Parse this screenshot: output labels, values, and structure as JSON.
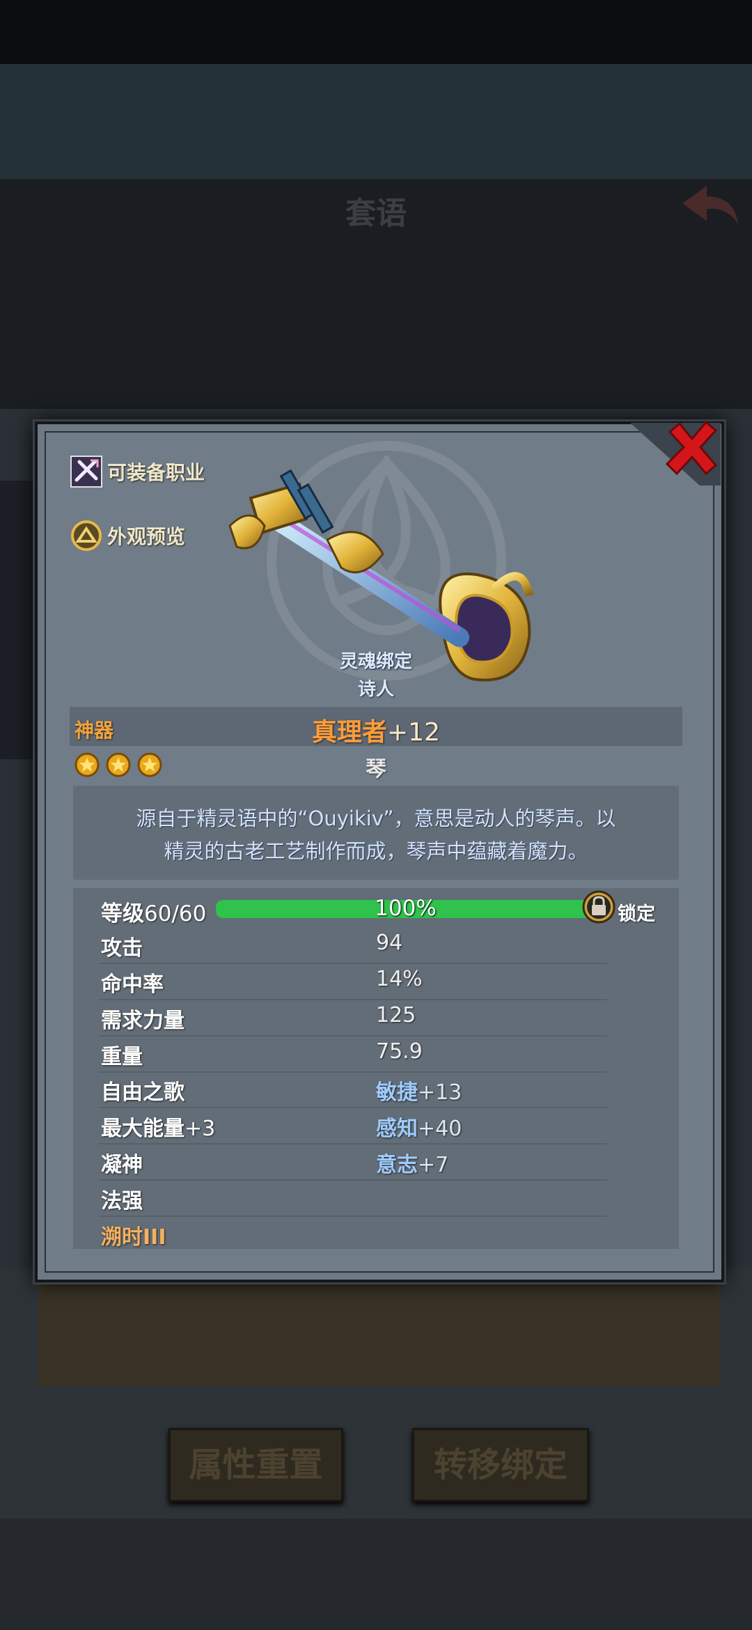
{
  "background": {
    "title": "套语"
  },
  "side_buttons": {
    "equip_class": "可装备职业",
    "appearance": "外观预览"
  },
  "item": {
    "soul_bound": "灵魂绑定",
    "bound_class": "诗人",
    "rarity": "神器",
    "name": "真理者",
    "enhance": "+12",
    "stars": 3,
    "type": "琴",
    "description_line1": "源自于精灵语中的“Ouyikiv”，意思是动人的琴声。以",
    "description_line2": "精灵的古老工艺制作而成，琴声中蕴藏着魔力。"
  },
  "level": {
    "label": "等级",
    "value": "60/60",
    "progress_text": "100%",
    "progress": 1.0,
    "lock_label": "锁定"
  },
  "stats": [
    {
      "key": "攻击",
      "value": "94"
    },
    {
      "key": "命中率",
      "value": "14%"
    },
    {
      "key": "需求力量",
      "value": "125"
    },
    {
      "key": "重量",
      "value": "75.9"
    }
  ],
  "affixes": [
    {
      "key": "自由之歌",
      "value_name": "敏捷",
      "value_num": "+13"
    },
    {
      "key_name": "最大能量",
      "key_num": "+3",
      "value_name": "感知",
      "value_num": "+40"
    },
    {
      "key": "凝神",
      "value_name": "意志",
      "value_num": "+7"
    },
    {
      "key": "法强"
    },
    {
      "key": "溯时III"
    }
  ],
  "bottom_buttons": {
    "reset": "属性重置",
    "transfer": "转移绑定"
  },
  "colors": {
    "rarity": "#f2a23a",
    "name": "#ff9d3a",
    "progress": "#2fc24c",
    "affix_value": "#9fcbff",
    "close": "#d4161b"
  }
}
